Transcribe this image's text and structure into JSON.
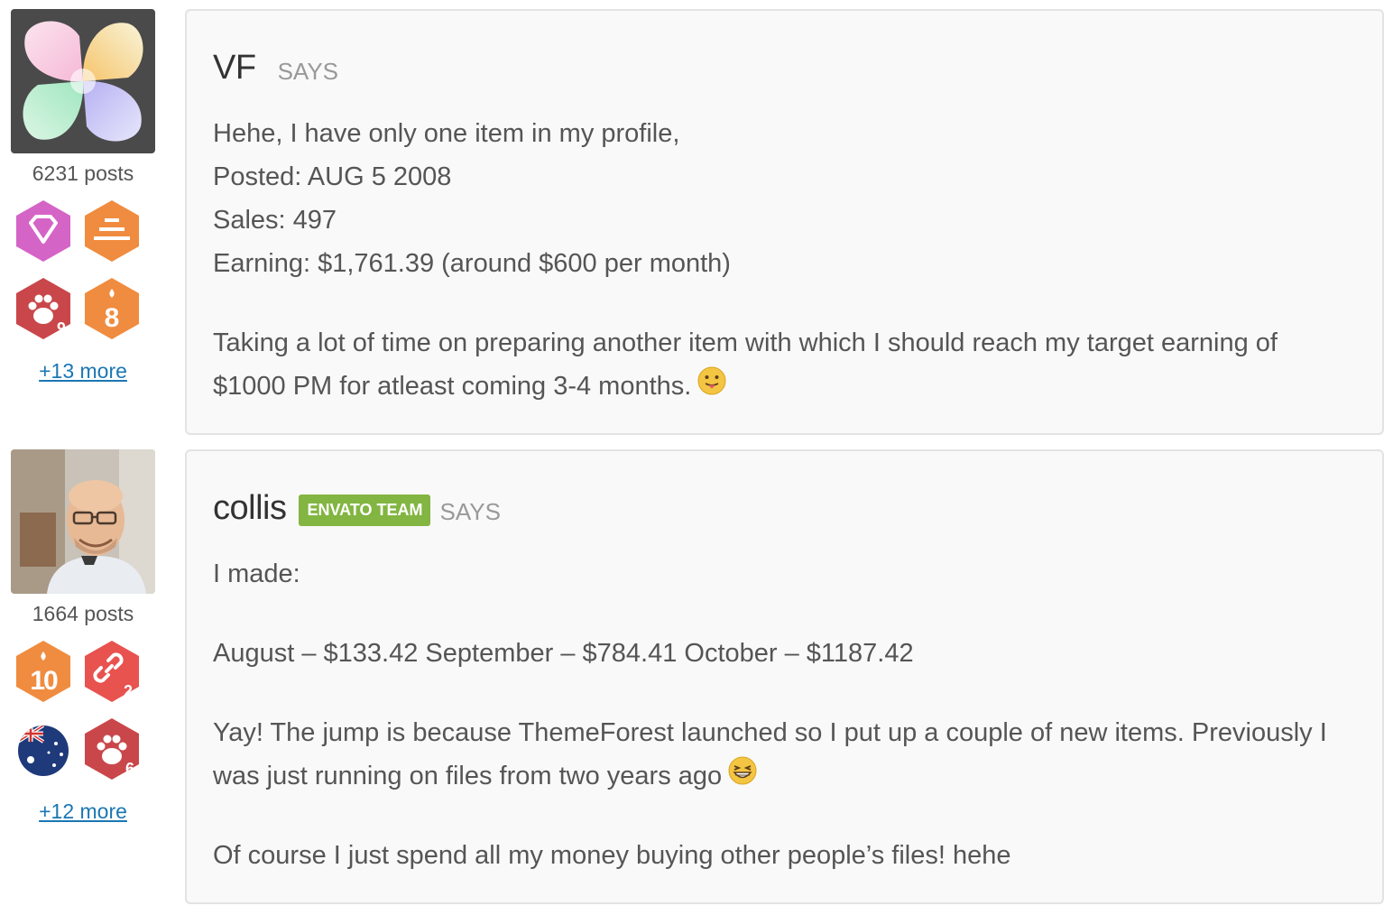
{
  "posts": [
    {
      "username": "VF",
      "says": "SAYS",
      "post_count": "6231 posts",
      "badges": [
        {
          "icon": "diamond-icon",
          "color": "#d564c7"
        },
        {
          "icon": "stack-icon",
          "color": "#f08c3f"
        },
        {
          "icon": "paw-icon",
          "color": "#c9474a",
          "count": "9"
        },
        {
          "icon": "flame-icon",
          "color": "#f08c3f",
          "count": "8"
        }
      ],
      "more_link": "+13 more",
      "lines": [
        "Hehe, I have only one item in my profile,",
        "Posted: AUG 5 2008",
        "Sales: 497",
        "Earning: $1,761.39 (around $600 per month)"
      ],
      "paragraph": "Taking a lot of time on preparing another item with which I should reach my target earning of $1000 PM for atleast coming 3-4 months.",
      "emoji": "tongue-emoji-icon"
    },
    {
      "username": "collis",
      "team_badge": "ENVATO TEAM",
      "says": "SAYS",
      "post_count": "1664 posts",
      "badges": [
        {
          "icon": "flame-icon",
          "color": "#f08c3f",
          "count": "10"
        },
        {
          "icon": "link-icon",
          "color": "#e8524f",
          "count": "2"
        },
        {
          "icon": "australia-flag-icon",
          "color": "#1f3a7a"
        },
        {
          "icon": "paw-icon",
          "color": "#c9474a",
          "count": "6"
        }
      ],
      "more_link": "+12 more",
      "p1": "I made:",
      "p2": "August – $133.42 September – $784.41 October – $1187.42",
      "p3": "Yay! The jump is because ThemeForest launched so I put up a couple of new items. Previously I was just running on files from two years ago",
      "p4": "Of course I just spend all my money buying other people’s files! hehe",
      "emoji": "grin-emoji-icon"
    }
  ]
}
